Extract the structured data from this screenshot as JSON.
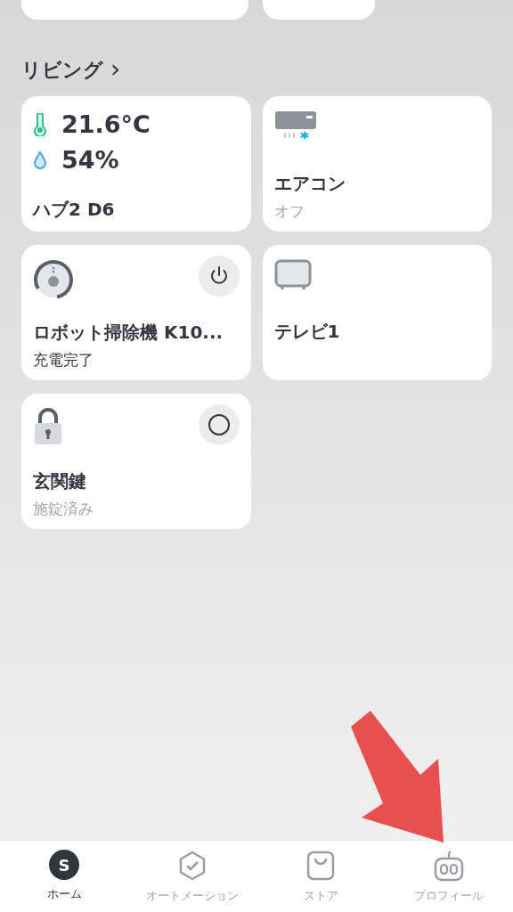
{
  "room": {
    "title": "リビング",
    "chevron": "›"
  },
  "devices": [
    {
      "kind": "hub",
      "temperature": "21.6°C",
      "humidity": "54%",
      "name": "ハブ2 D6"
    },
    {
      "kind": "ac",
      "name": "エアコン",
      "status": "オフ",
      "active": false
    },
    {
      "kind": "robot",
      "name": "ロボット掃除機 K10...",
      "status": "充電完了",
      "active": true,
      "control": {
        "kind": "power"
      }
    },
    {
      "kind": "tv",
      "name": "テレビ1"
    },
    {
      "kind": "lock",
      "name": "玄関鍵",
      "status": "施錠済み",
      "active": false,
      "control": {
        "kind": "circle"
      }
    }
  ],
  "tabs": [
    {
      "kind": "home",
      "label": "ホーム",
      "icon_letter": "S",
      "selected": true
    },
    {
      "kind": "automation",
      "label": "オートメーション",
      "selected": false
    },
    {
      "kind": "store",
      "label": "ストア",
      "selected": false
    },
    {
      "kind": "profile",
      "label": "プロフィール",
      "selected": false
    }
  ]
}
